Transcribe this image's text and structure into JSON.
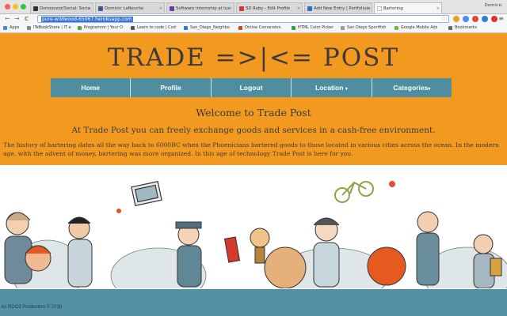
{
  "browser": {
    "tabs": [
      {
        "label": "Dsmzzzzzz/Social: Socia",
        "color": "#333333",
        "active": false
      },
      {
        "label": "Dominic LaRouche",
        "color": "#3b5998",
        "active": false
      },
      {
        "label": "Software internship at lux",
        "color": "#6a3fa0",
        "active": false
      },
      {
        "label": "SD Ruby - Edit Profile",
        "color": "#d9383a",
        "active": false
      },
      {
        "label": "Add New Entry | Portfolium",
        "color": "#2d6fc2",
        "active": false
      },
      {
        "label": "Bartering",
        "color": "#bbbbbb",
        "active": true
      }
    ],
    "profile_name": "Dominic",
    "url": "pure-wildwood-65067.herokuapp.com",
    "bookmarks": [
      {
        "label": "Apps",
        "color": "#4a88d8"
      },
      {
        "label": "ITeBookShare | IT e",
        "color": "#888888"
      },
      {
        "label": "Programmr | Your O",
        "color": "#5aa43a"
      },
      {
        "label": "Learn to code | Cod",
        "color": "#555555"
      },
      {
        "label": "San_Diego_Neighbo",
        "color": "#3477c4"
      },
      {
        "label": "Online Conversion",
        "color": "#c44b2e"
      },
      {
        "label": "HTML Color Picker",
        "color": "#2f9e44"
      },
      {
        "label": "San Diego Sportfish",
        "color": "#999999"
      },
      {
        "label": "Google Mobile Ads",
        "color": "#78b33c"
      },
      {
        "label": "Bookmarks",
        "color": "#666666"
      }
    ],
    "icons": {
      "back": "←",
      "forward": "→",
      "reload": "C",
      "star": "☆",
      "menu": "≡"
    }
  },
  "site": {
    "title": "TRADE =>|<= POST",
    "nav": [
      {
        "label": "Home"
      },
      {
        "label": "Profile"
      },
      {
        "label": "Logout"
      },
      {
        "label": "Location"
      },
      {
        "label": "Categories"
      }
    ],
    "dropdown_caret": "▾",
    "welcome": "Welcome to Trade Post",
    "tagline": "At Trade Post you can freely exchange goods and services in a cash-free environment.",
    "history": "The history of bartering dates all the way back to 6000BC when the Phoenicians bartered goods to those located in various cities across the ocean. In the modern age, with the advent of money, bartering was more organized. In this age of technology Trade Post is here for you.",
    "footer": "An RDO3 Production © 2016"
  },
  "colors": {
    "hero": "#f29a1f",
    "nav": "#4e8ea0",
    "footer": "#5490a4"
  }
}
